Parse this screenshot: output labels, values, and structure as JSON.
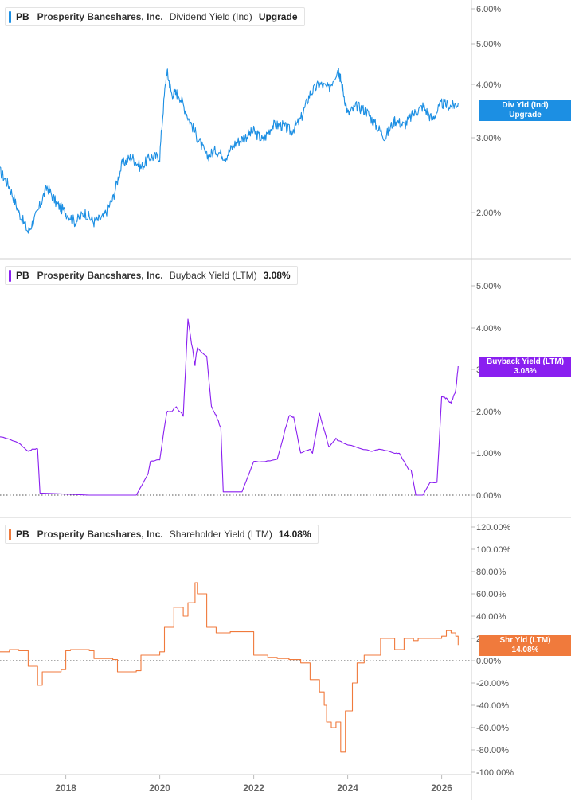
{
  "colors": {
    "dividend": "#1c8fe3",
    "buyback": "#8a1ff0",
    "shareholder": "#f07a3c",
    "grid": "#d9d9d9",
    "axis_text": "#555555"
  },
  "x_axis": {
    "ticks": [
      "2018",
      "2020",
      "2022",
      "2024",
      "2026"
    ]
  },
  "panels": [
    {
      "ticker": "PB",
      "company": "Prosperity Bancshares, Inc.",
      "metric": "Dividend Yield (Ind)",
      "value": "Upgrade",
      "tag_line1": "Div Yld (Ind)",
      "tag_line2": "Upgrade",
      "y_ticks": [
        "6.00%",
        "5.00%",
        "4.00%",
        "3.00%",
        "2.00%"
      ]
    },
    {
      "ticker": "PB",
      "company": "Prosperity Bancshares, Inc.",
      "metric": "Buyback Yield (LTM)",
      "value": "3.08%",
      "tag_line1": "Buyback Yield (LTM)",
      "tag_line2": "3.08%",
      "y_ticks": [
        "5.00%",
        "4.00%",
        "3.00%",
        "2.00%",
        "1.00%",
        "0.00%"
      ]
    },
    {
      "ticker": "PB",
      "company": "Prosperity Bancshares, Inc.",
      "metric": "Shareholder Yield (LTM)",
      "value": "14.08%",
      "tag_line1": "Shr Yld (LTM)",
      "tag_line2": "14.08%",
      "y_ticks": [
        "120.00%",
        "100.00%",
        "80.00%",
        "60.00%",
        "40.00%",
        "20.00%",
        "0.00%",
        "-20.00%",
        "-40.00%",
        "-60.00%",
        "-80.00%",
        "-100.00%"
      ]
    }
  ],
  "chart_data": [
    {
      "type": "line",
      "series": [
        {
          "name": "Dividend Yield (Ind)",
          "unit": "%",
          "x": [
            2016.6,
            2016.8,
            2017.0,
            2017.2,
            2017.4,
            2017.6,
            2017.8,
            2018.0,
            2018.2,
            2018.4,
            2018.6,
            2018.8,
            2019.0,
            2019.2,
            2019.4,
            2019.6,
            2019.8,
            2020.0,
            2020.15,
            2020.25,
            2020.4,
            2020.6,
            2020.8,
            2021.0,
            2021.2,
            2021.4,
            2021.6,
            2021.8,
            2022.0,
            2022.2,
            2022.4,
            2022.6,
            2022.8,
            2023.0,
            2023.2,
            2023.4,
            2023.6,
            2023.8,
            2023.85,
            2024.0,
            2024.2,
            2024.4,
            2024.6,
            2024.8,
            2025.0,
            2025.2,
            2025.4,
            2025.6,
            2025.8,
            2026.0,
            2026.2,
            2026.35
          ],
          "y": [
            2.5,
            2.3,
            2.0,
            1.8,
            2.0,
            2.3,
            2.1,
            2.0,
            1.9,
            2.0,
            1.9,
            1.95,
            2.15,
            2.6,
            2.7,
            2.55,
            2.7,
            2.7,
            4.3,
            3.8,
            3.8,
            3.35,
            3.0,
            2.7,
            2.8,
            2.7,
            2.9,
            3.0,
            3.1,
            2.95,
            3.2,
            3.2,
            3.1,
            3.3,
            3.8,
            4.0,
            3.9,
            4.35,
            4.1,
            3.4,
            3.55,
            3.45,
            3.2,
            3.0,
            3.3,
            3.2,
            3.4,
            3.55,
            3.3,
            3.6,
            3.55,
            3.6
          ]
        }
      ],
      "ylim": [
        1.6,
        6.2
      ],
      "y_scale": "log"
    },
    {
      "type": "line",
      "series": [
        {
          "name": "Buyback Yield (LTM)",
          "unit": "%",
          "x": [
            2016.6,
            2017.0,
            2017.2,
            2017.3,
            2017.4,
            2017.45,
            2018.5,
            2019.0,
            2019.5,
            2019.75,
            2019.8,
            2020.0,
            2020.15,
            2020.25,
            2020.35,
            2020.5,
            2020.6,
            2020.75,
            2020.8,
            2021.0,
            2021.1,
            2021.2,
            2021.3,
            2021.35,
            2021.5,
            2021.75,
            2022.0,
            2022.2,
            2022.5,
            2022.75,
            2022.85,
            2023.0,
            2023.2,
            2023.25,
            2023.4,
            2023.6,
            2023.75,
            2023.8,
            2024.0,
            2024.5,
            2024.7,
            2025.0,
            2025.1,
            2025.3,
            2025.35,
            2025.45,
            2025.5,
            2025.6,
            2025.75,
            2025.8,
            2025.9,
            2026.0,
            2026.1,
            2026.2,
            2026.3,
            2026.35
          ],
          "y": [
            1.4,
            1.25,
            1.05,
            1.1,
            1.1,
            0.05,
            0.0,
            0.0,
            0.0,
            0.5,
            0.8,
            0.85,
            2.0,
            2.0,
            2.1,
            1.9,
            4.2,
            3.1,
            3.55,
            3.3,
            2.1,
            1.9,
            1.6,
            0.08,
            0.08,
            0.08,
            0.8,
            0.8,
            0.85,
            1.9,
            1.85,
            1.0,
            1.1,
            1.0,
            1.95,
            1.15,
            1.35,
            1.3,
            1.2,
            1.05,
            1.1,
            1.0,
            1.0,
            0.6,
            0.6,
            0.0,
            0.0,
            0.0,
            0.3,
            0.3,
            0.3,
            2.35,
            2.3,
            2.2,
            2.5,
            3.08
          ]
        }
      ],
      "ylim": [
        -0.3,
        5.7
      ]
    },
    {
      "type": "line",
      "series": [
        {
          "name": "Shareholder Yield (LTM)",
          "unit": "%",
          "x": [
            2016.6,
            2016.8,
            2017.0,
            2017.2,
            2017.4,
            2017.45,
            2017.5,
            2017.9,
            2018.0,
            2018.1,
            2018.5,
            2018.6,
            2019.0,
            2019.1,
            2019.5,
            2019.6,
            2020.0,
            2020.1,
            2020.3,
            2020.5,
            2020.6,
            2020.75,
            2020.8,
            2021.0,
            2021.2,
            2021.5,
            2022.0,
            2022.3,
            2022.5,
            2022.75,
            2023.0,
            2023.2,
            2023.4,
            2023.5,
            2023.55,
            2023.65,
            2023.75,
            2023.85,
            2023.95,
            2024.1,
            2024.2,
            2024.35,
            2024.5,
            2024.7,
            2024.9,
            2025.0,
            2025.2,
            2025.4,
            2025.5,
            2025.8,
            2026.0,
            2026.1,
            2026.2,
            2026.3,
            2026.35
          ],
          "y": [
            8,
            10,
            9,
            -5,
            -22,
            -22,
            -10,
            -8,
            9,
            10,
            9,
            2,
            1,
            -10,
            -9,
            5,
            8,
            30,
            48,
            40,
            52,
            70,
            60,
            30,
            25,
            26,
            5,
            3,
            2,
            1,
            -2,
            -17,
            -28,
            -40,
            -55,
            -60,
            -55,
            -82,
            -45,
            -20,
            -2,
            5,
            5,
            20,
            20,
            10,
            20,
            18,
            20,
            20,
            22,
            27,
            25,
            22,
            14.08
          ]
        }
      ],
      "ylim": [
        -100,
        120
      ]
    }
  ]
}
